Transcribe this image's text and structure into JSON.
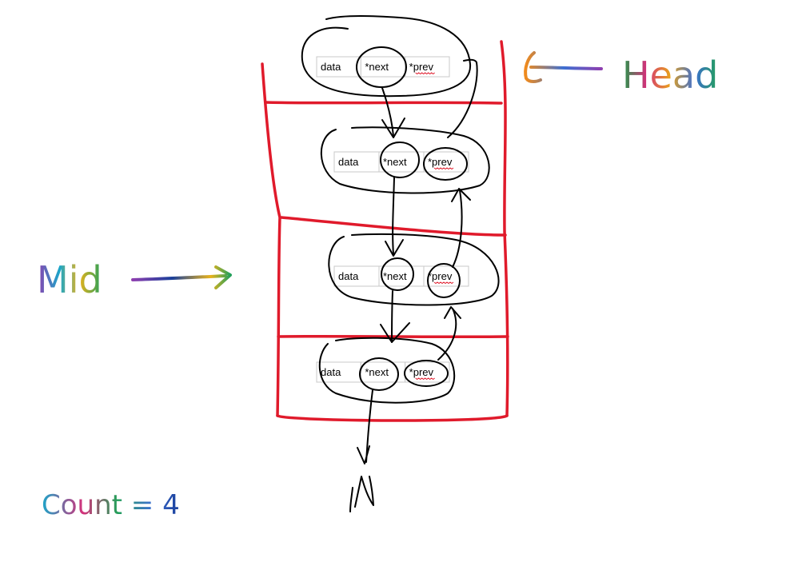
{
  "nodes": [
    {
      "data": "data",
      "next": "*next",
      "prev": "*prev"
    },
    {
      "data": "data",
      "next": "*next",
      "prev": "*prev"
    },
    {
      "data": "data",
      "next": "*next",
      "prev": "*prev"
    },
    {
      "data": "data",
      "next": "*next",
      "prev": "*prev"
    }
  ],
  "labels": {
    "head": "Head",
    "mid": "Mid",
    "count": "Count = 4",
    "null_marker": "N"
  },
  "colors": {
    "stack_outline": "#e01a2b",
    "ink": "#000000",
    "cell_border": "#c8c8c8",
    "spellcheck": "#e01a2b"
  },
  "rainbow": [
    "#f08a1c",
    "#3c6fd1",
    "#8e3fb0",
    "#d4307a",
    "#23a05a",
    "#1aa6c9",
    "#e8b31c"
  ]
}
